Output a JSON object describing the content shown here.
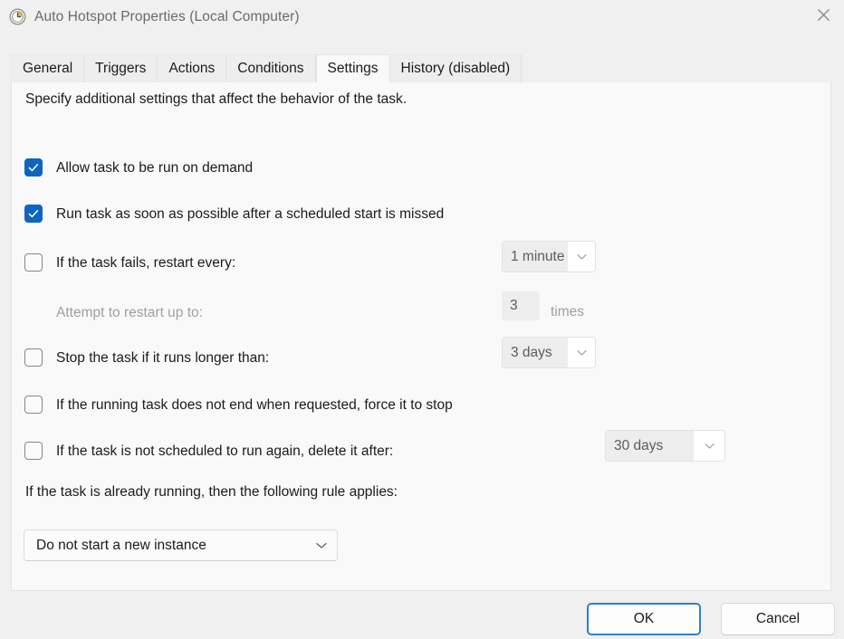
{
  "window": {
    "title": "Auto Hotspot Properties (Local Computer)",
    "icon": "clock-icon",
    "close_label": "Close"
  },
  "tabs": [
    {
      "label": "General",
      "active": false
    },
    {
      "label": "Triggers",
      "active": false
    },
    {
      "label": "Actions",
      "active": false
    },
    {
      "label": "Conditions",
      "active": false
    },
    {
      "label": "Settings",
      "active": true
    },
    {
      "label": "History (disabled)",
      "active": false
    }
  ],
  "settings": {
    "intro": "Specify additional settings that affect the behavior of the task.",
    "rows": [
      {
        "label": "Allow task to be run on demand",
        "checked": true,
        "disabled": false
      },
      {
        "label": "Run task as soon as possible after a scheduled start is missed",
        "checked": true,
        "disabled": false
      },
      {
        "label": "If the task fails, restart every:",
        "checked": false,
        "disabled": false,
        "combo_value": "1 minute"
      },
      {
        "label": "Attempt to restart up to:",
        "disabled": true,
        "field_value": "3",
        "unit": "times"
      },
      {
        "label": "Stop the task if it runs longer than:",
        "checked": false,
        "disabled": false,
        "combo_value": "3 days"
      },
      {
        "label": "If the running task does not end when requested, force it to stop",
        "checked": false,
        "disabled": false
      },
      {
        "label": "If the task is not scheduled to run again, delete it after:",
        "checked": false,
        "disabled": false,
        "combo_value": "30 days"
      }
    ],
    "rule_label": "If the task is already running, then the following rule applies:",
    "rule_value": "Do not start a new instance"
  },
  "footer": {
    "ok_label": "OK",
    "cancel_label": "Cancel"
  },
  "colors": {
    "accent": "#0d65bf",
    "focus_border": "#2f7fd0",
    "dialog_bg": "#f0f0f0",
    "panel_bg": "#f9f9f9",
    "text": "#1b1b1b",
    "disabled_text": "#a0a0a0"
  }
}
